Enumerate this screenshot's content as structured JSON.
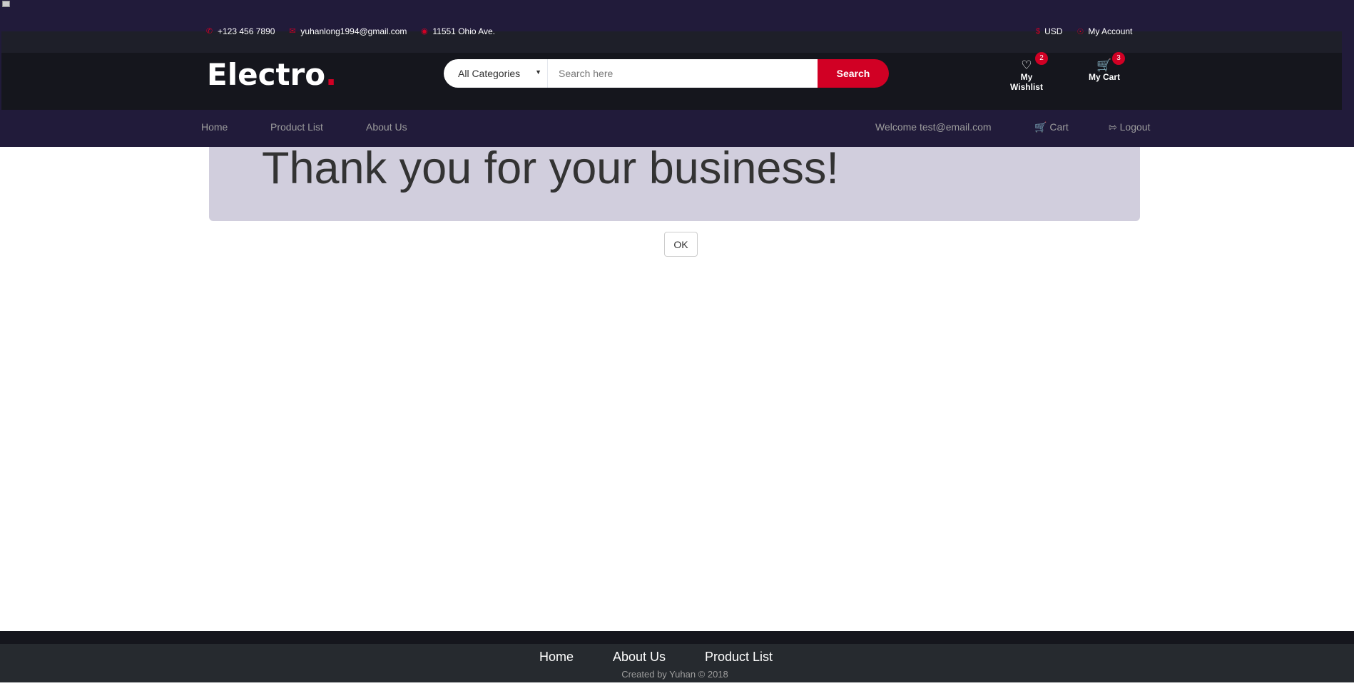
{
  "topbar": {
    "phone": "+123 456 7890",
    "email": "yuhanlong1994@gmail.com",
    "address": "11551 Ohio Ave.",
    "currency": "USD",
    "account": "My Account"
  },
  "header": {
    "logo": "Electro",
    "logo_dot": ".",
    "category": "All Categories",
    "search_placeholder": "Search here",
    "search_button": "Search",
    "wishlist_label": "My Wishlist",
    "wishlist_count": "2",
    "cart_label": "My Cart",
    "cart_count": "3"
  },
  "nav": {
    "home": "Home",
    "product_list": "Product List",
    "about_us": "About Us",
    "welcome": "Welcome test@email.com",
    "cart": "Cart",
    "logout": "Logout"
  },
  "main": {
    "heading": "Thank you for your business!",
    "ok_button": "OK"
  },
  "footer": {
    "home": "Home",
    "about_us": "About Us",
    "product_list": "Product List",
    "copyright": "Created by Yuhan © 2018"
  },
  "colors": {
    "accent": "#d10024",
    "nav_bg": "#211b3a",
    "header_bg": "#15161d",
    "jumbotron_bg": "#d1cedd"
  },
  "icons": [
    "phone-icon",
    "envelope-icon",
    "map-marker-icon",
    "dollar-icon",
    "user-icon",
    "heart-icon",
    "cart-icon",
    "logout-icon"
  ]
}
